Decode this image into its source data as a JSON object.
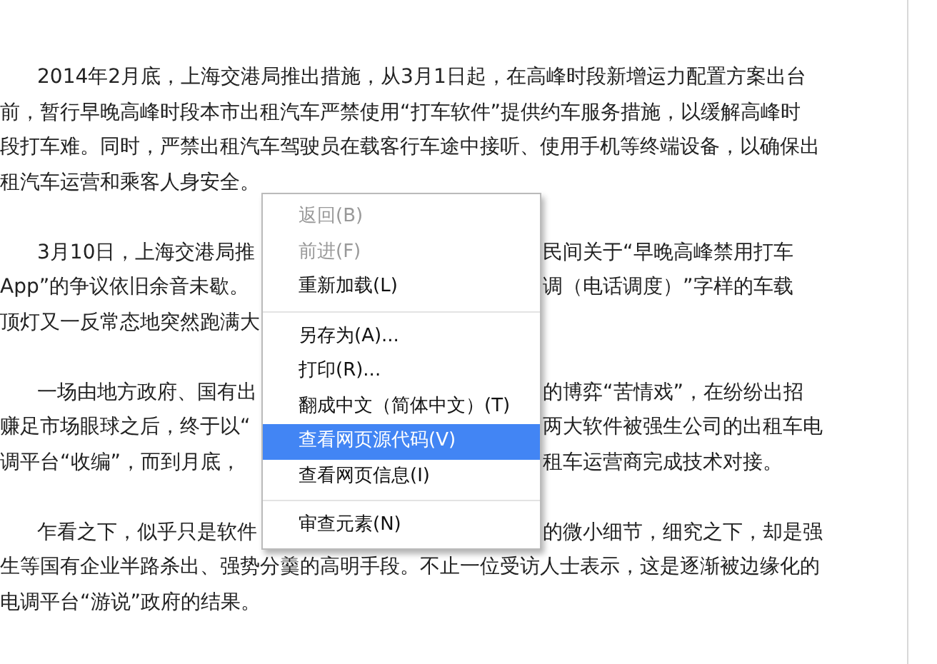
{
  "article": {
    "paragraphs": [
      {
        "lines": [
          {
            "left": "2014年2月底，上海交港局推出措施，从3月1日起，在高峰时段新增运力配置方案出台"
          },
          {
            "left": "前，暂行早晚高峰时段本市出租汽车严禁使用“打车软件”提供约车服务措施，以缓解高峰时"
          },
          {
            "left": "段打车难。同时，严禁出租汽车驾驶员在载客行车途中接听、使用手机等终端设备，以确保出"
          },
          {
            "left": "租汽车运营和乘客人身安全。"
          }
        ]
      },
      {
        "lines": [
          {
            "left": "3月10日，上海交港局推",
            "right": "民间关于“早晚高峰禁用打车"
          },
          {
            "left": "App”的争议依旧余音未歇。",
            "right": "调（电话调度）”字样的车载"
          },
          {
            "left": "顶灯又一反常态地突然跑满大"
          }
        ]
      },
      {
        "lines": [
          {
            "left": "一场由地方政府、国有出",
            "right": "的博弈“苦情戏”，在纷纷出招"
          },
          {
            "left": "赚足市场眼球之后，终于以“",
            "right": "两大软件被强生公司的出租车电"
          },
          {
            "left": "调平台“收编”，而到月底，",
            "right": "租车运营商完成技术对接。"
          }
        ]
      },
      {
        "lines": [
          {
            "left": "乍看之下，似乎只是软件",
            "right": "的微小细节，细究之下，却是强"
          },
          {
            "left": "生等国有企业半路杀出、强势分羹的高明手段。不止一位受访人士表示，这是逐渐被边缘化的"
          },
          {
            "left": "电调平台“游说”政府的结果。"
          }
        ]
      }
    ]
  },
  "context_menu": {
    "items": [
      {
        "kind": "item",
        "label": "返回(B)",
        "disabled": true,
        "selected": false
      },
      {
        "kind": "item",
        "label": "前进(F)",
        "disabled": true,
        "selected": false
      },
      {
        "kind": "item",
        "label": "重新加载(L)",
        "disabled": false,
        "selected": false
      },
      {
        "kind": "separator"
      },
      {
        "kind": "item",
        "label": "另存为(A)...",
        "disabled": false,
        "selected": false
      },
      {
        "kind": "item",
        "label": "打印(R)...",
        "disabled": false,
        "selected": false
      },
      {
        "kind": "item",
        "label": "翻成中文（简体中文）(T)",
        "disabled": false,
        "selected": false
      },
      {
        "kind": "item",
        "label": "查看网页源代码(V)",
        "disabled": false,
        "selected": true
      },
      {
        "kind": "item",
        "label": "查看网页信息(I)",
        "disabled": false,
        "selected": false
      },
      {
        "kind": "separator"
      },
      {
        "kind": "item",
        "label": "审查元素(N)",
        "disabled": false,
        "selected": false
      }
    ]
  }
}
